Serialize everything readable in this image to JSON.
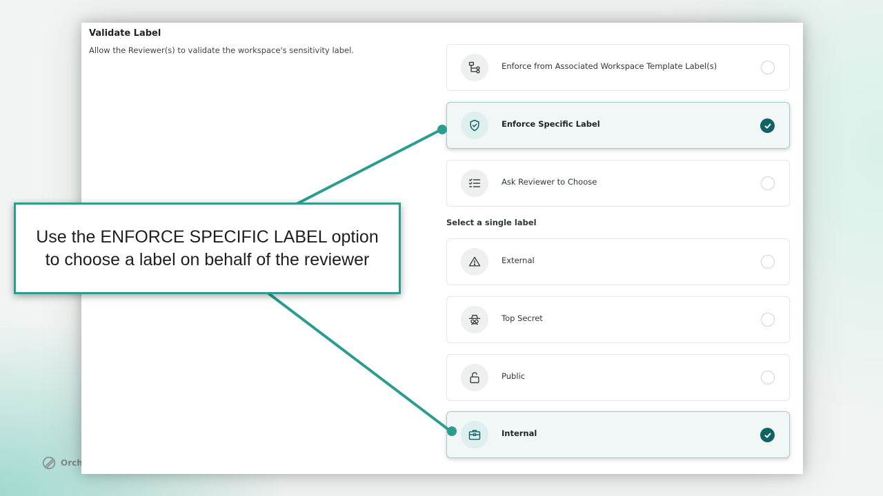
{
  "brand": {
    "text": "Orch"
  },
  "section": {
    "title": "Validate Label",
    "description": "Allow the Reviewer(s) to validate the workspace's sensitivity label."
  },
  "enforcement_options": [
    {
      "label": "Enforce from Associated Workspace Template Label(s)",
      "icon": "template-tree-icon",
      "selected": false
    },
    {
      "label": "Enforce Specific Label",
      "icon": "shield-check-icon",
      "selected": true
    },
    {
      "label": "Ask Reviewer to Choose",
      "icon": "checklist-icon",
      "selected": false
    }
  ],
  "label_section": {
    "heading": "Select a single label"
  },
  "labels": [
    {
      "label": "External",
      "icon": "warning-triangle-icon",
      "selected": false
    },
    {
      "label": "Top Secret",
      "icon": "spy-icon",
      "selected": false
    },
    {
      "label": "Public",
      "icon": "unlock-icon",
      "selected": false
    },
    {
      "label": "Internal",
      "icon": "briefcase-icon",
      "selected": true
    }
  ],
  "callout": {
    "text": "Use the ENFORCE SPECIFIC LABEL option to choose a label on behalf of the reviewer"
  },
  "colors": {
    "accent": "#116263",
    "callout_border": "#2a9d8f",
    "selected_bg": "#f1f7f7"
  }
}
